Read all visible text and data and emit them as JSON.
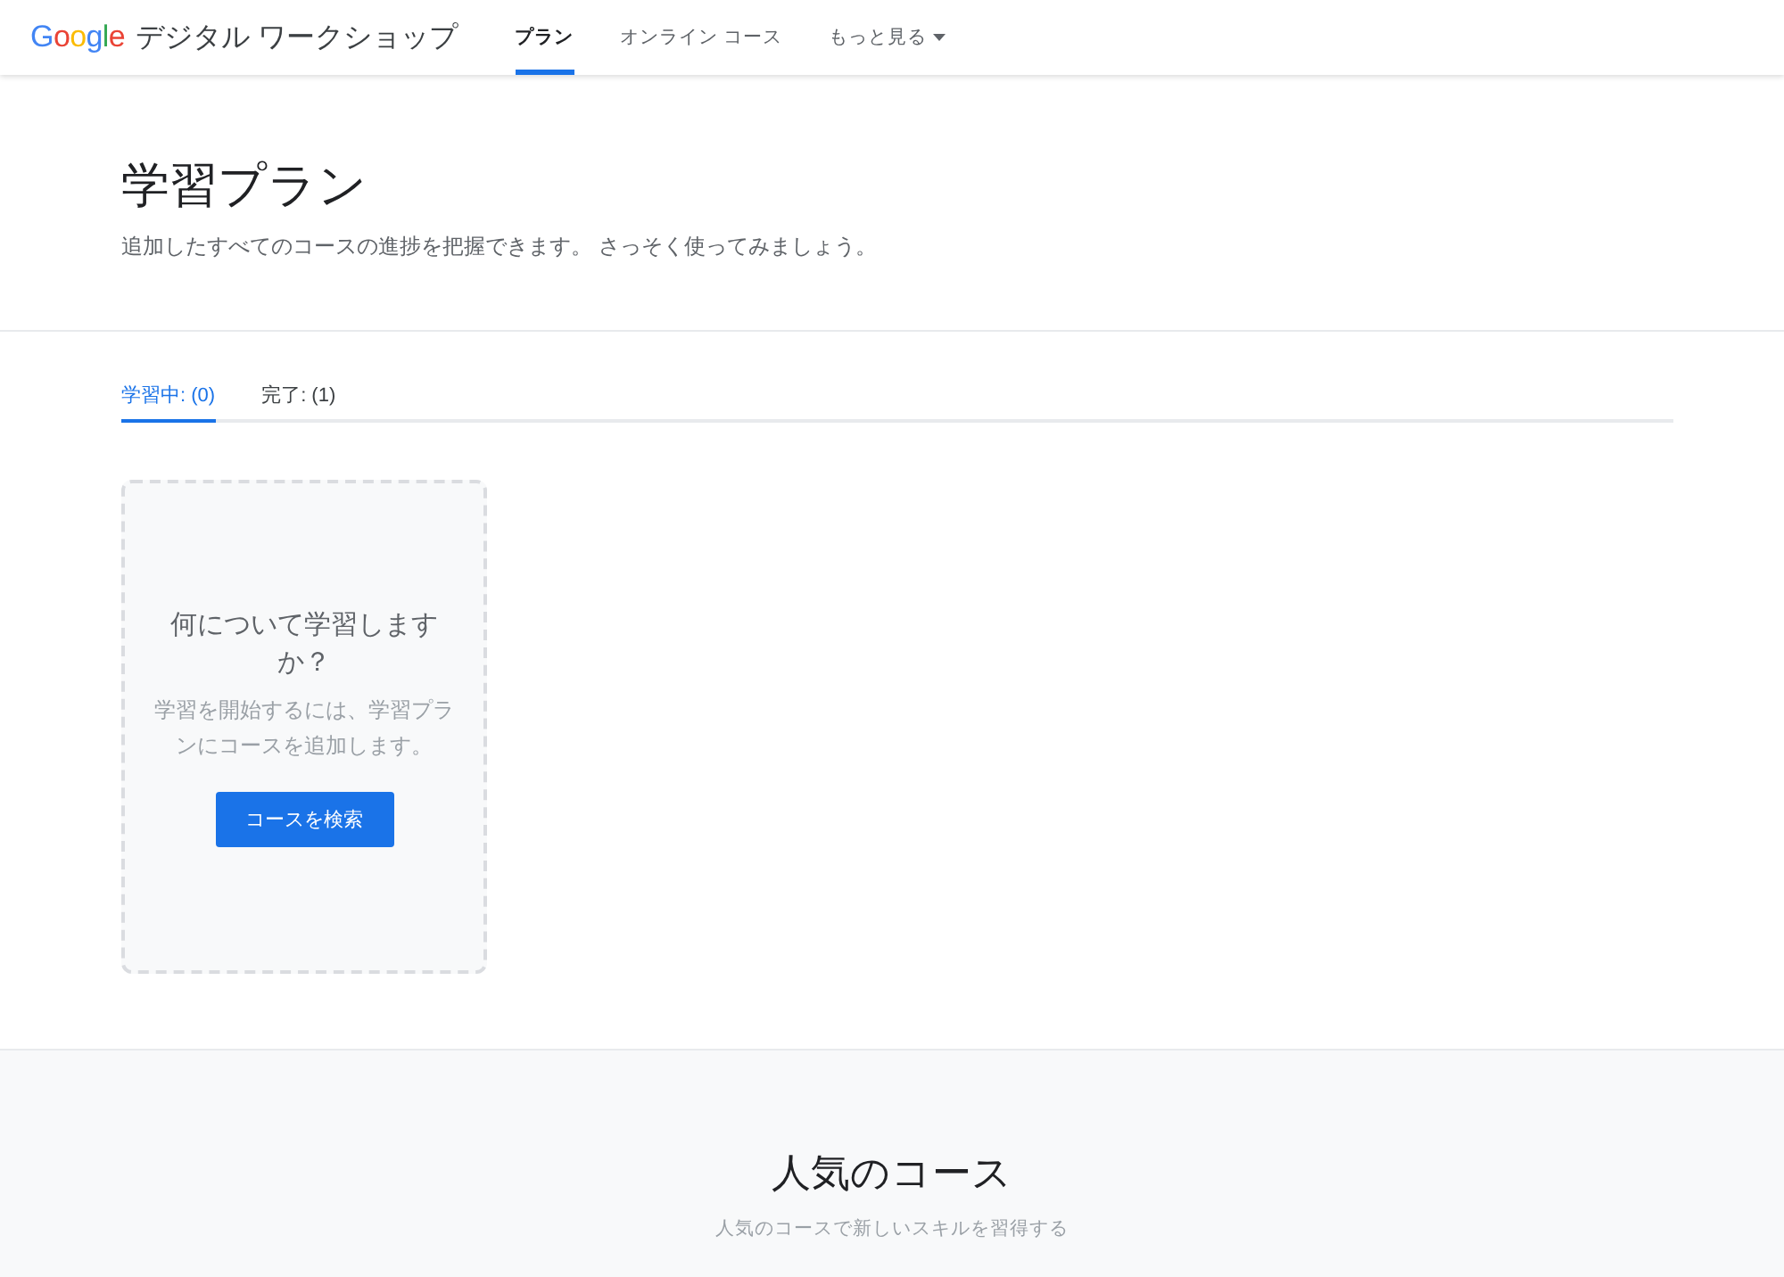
{
  "header": {
    "logo": "Google",
    "site_title": "デジタル ワークショップ",
    "nav": [
      {
        "label": "プラン",
        "selected": true,
        "dropdown": false
      },
      {
        "label": "オンライン コース",
        "selected": false,
        "dropdown": false
      },
      {
        "label": "もっと見る",
        "selected": false,
        "dropdown": true
      }
    ]
  },
  "hero": {
    "title": "学習プラン",
    "subtitle": "追加したすべてのコースの進捗を把握できます。 さっそく使ってみましょう。"
  },
  "tabs": [
    {
      "label": "学習中: (0)",
      "selected": true
    },
    {
      "label": "完了: (1)",
      "selected": false
    }
  ],
  "empty_card": {
    "title": "何について学習しますか？",
    "text": "学習を開始するには、学習プランにコースを追加します。",
    "button": "コースを検索"
  },
  "popular": {
    "title": "人気のコース",
    "subtitle": "人気のコースで新しいスキルを習得する"
  }
}
